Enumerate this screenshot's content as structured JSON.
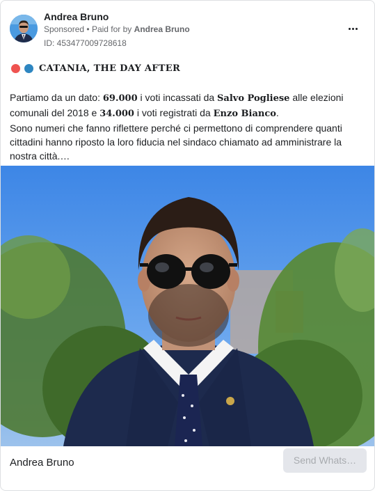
{
  "post": {
    "author": "Andrea Bruno",
    "sponsored_label": "Sponsored",
    "paid_prefix": "Paid for by",
    "paid_by": "Andrea Bruno",
    "ad_id": "ID: 453477009728618"
  },
  "headline": {
    "text": "CATANIA, THE DAY AFTER",
    "dot_colors": [
      "#ef5350",
      "#2e86c1"
    ]
  },
  "body": {
    "t1": "Partiamo da un dato: ",
    "n1": "69.000",
    "t2": " i voti incassati da ",
    "name1": "Salvo Pogliese",
    "t3": " alle elezioni comunali del 2018 e ",
    "n2": "34.000",
    "t4": " i voti registrati da ",
    "name2": "Enzo Bianco",
    "t5": ".",
    "p2": "Sono numeri che fanno riflettere perché ci permettono di comprendere quanti cittadini hanno riposto la loro fiducia nel sindaco chiamato ad amministrare la nostra città.…"
  },
  "footer": {
    "page_name": "Andrea Bruno",
    "cta_label": "Send Whats…"
  },
  "icons": {
    "more": "more-horizontal-icon",
    "verified": "none"
  }
}
